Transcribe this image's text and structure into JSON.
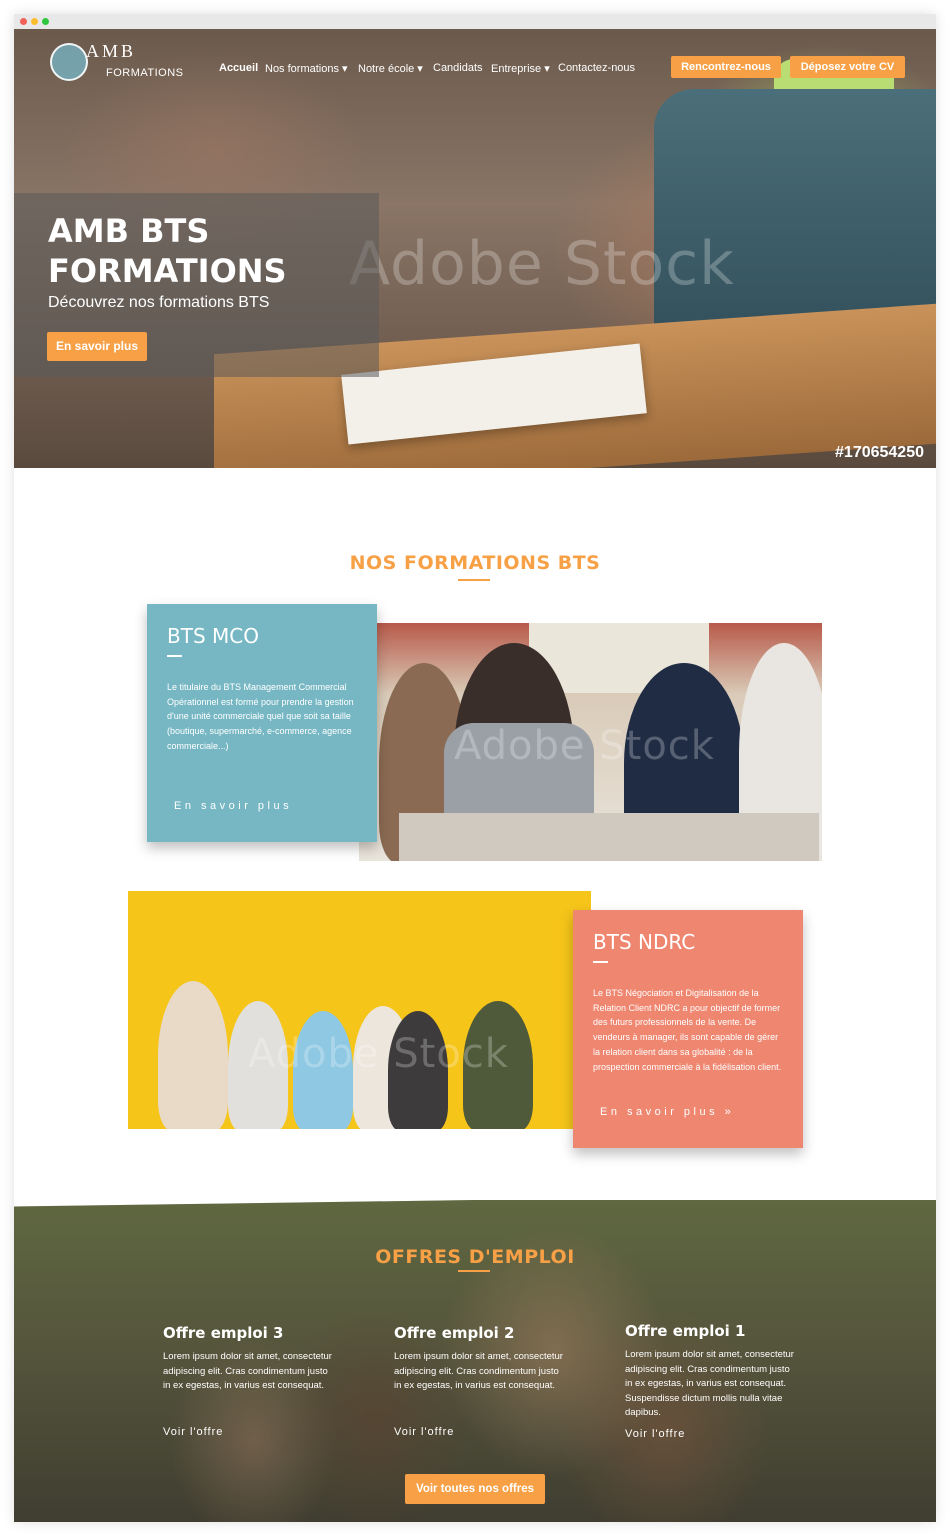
{
  "nav": {
    "logo_main": "AMB",
    "logo_sub": "FORMATIONS",
    "items": [
      "Accueil",
      "Nos formations ▾",
      "Notre école ▾",
      "Candidats",
      "Entreprise ▾",
      "Contactez-nous"
    ],
    "cta1": "Rencontrez-nous",
    "cta2": "Déposez votre CV"
  },
  "hero": {
    "title": "AMB BTS FORMATIONS",
    "subtitle": "Découvrez nos formations BTS",
    "button": "En savoir plus",
    "watermark": "Adobe Stock",
    "stock_id": "#170654250"
  },
  "formations": {
    "title": "NOS FORMATIONS BTS",
    "mco": {
      "title": "BTS MCO",
      "text": "Le titulaire du BTS Management Commercial Opérationnel est formé pour prendre la gestion d'une unité commerciale quel que soit sa taille (boutique, supermarché, e-commerce, agence commerciale...)",
      "link": "En savoir plus"
    },
    "ndrc": {
      "title": "BTS NDRC",
      "text": "Le BTS Négociation et Digitalisation de la Relation Client NDRC a pour objectif de former des futurs professionnels de la vente. De vendeurs à manager, ils sont capable de gérer la relation client dans sa globalité : de la prospection commerciale à la fidélisation client.",
      "link": "En savoir plus »"
    },
    "watermark": "Adobe Stock"
  },
  "offres": {
    "title": "OFFRES D'EMPLOI",
    "items": [
      {
        "title": "Offre emploi 3",
        "text": "Lorem ipsum dolor sit amet, consectetur adipiscing elit. Cras condimentum justo in ex egestas, in varius est consequat.",
        "link": "Voir l'offre"
      },
      {
        "title": "Offre emploi 2",
        "text": "Lorem ipsum dolor sit amet, consectetur adipiscing elit. Cras condimentum justo in ex egestas, in varius est consequat.",
        "link": "Voir l'offre"
      },
      {
        "title": "Offre emploi 1",
        "text": "Lorem ipsum dolor sit amet, consectetur adipiscing elit. Cras condimentum justo in ex egestas, in varius est consequat. Suspendisse dictum mollis nulla vitae dapibus.",
        "link": "Voir l'offre"
      }
    ],
    "button": "Voir toutes nos offres"
  },
  "colors": {
    "accent": "#f7a046",
    "mco": "#76b7c3",
    "ndrc": "#ee8670"
  }
}
